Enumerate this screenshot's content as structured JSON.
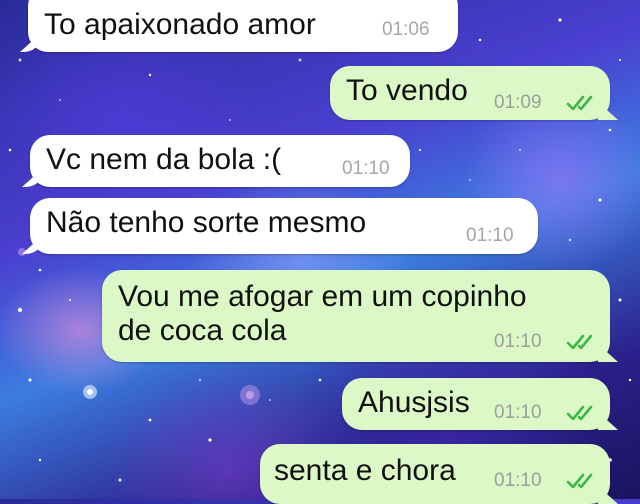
{
  "conversation": {
    "messages": [
      {
        "direction": "incoming",
        "text": "To apaixonado amor",
        "time": "01:06"
      },
      {
        "direction": "outgoing",
        "text": "To vendo",
        "time": "01:09",
        "status": "read"
      },
      {
        "direction": "incoming",
        "text": "Vc nem da bola :(",
        "time": "01:10"
      },
      {
        "direction": "incoming",
        "text": "Não tenho sorte mesmo",
        "time": "01:10"
      },
      {
        "direction": "outgoing",
        "text": "Vou me afogar em um copinho\nde coca cola",
        "time": "01:10",
        "status": "read"
      },
      {
        "direction": "outgoing",
        "text": "Ahusjsis",
        "time": "01:10",
        "status": "read"
      },
      {
        "direction": "outgoing",
        "text": "senta e chora",
        "time": "01:10",
        "status": "read"
      }
    ]
  },
  "colors": {
    "incoming_bubble": "#ffffff",
    "outgoing_bubble": "#dcf8c6",
    "read_ticks": "#3cb84a",
    "background": "galaxy-blue"
  },
  "icons": {
    "read_status": "double-check-icon"
  }
}
